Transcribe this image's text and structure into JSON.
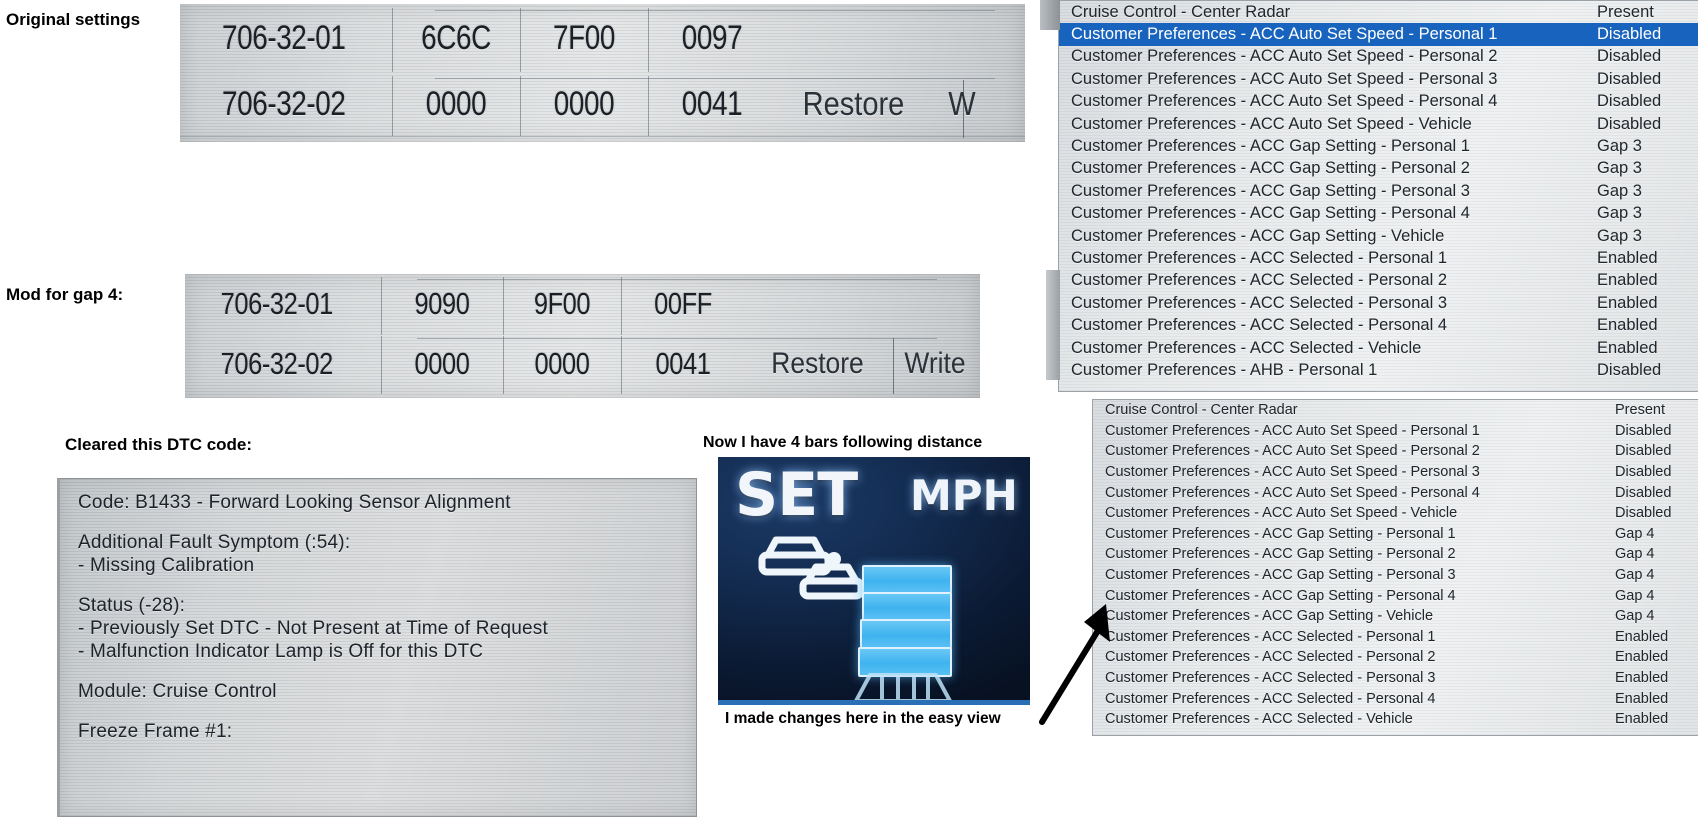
{
  "annotations": {
    "original_settings": "Original settings",
    "mod_for_gap4": "Mod for gap 4:",
    "cleared_dtc": "Cleared this DTC code:",
    "four_bars": "Now I have 4 bars following distance",
    "easy_view": "I made changes here in the easy view"
  },
  "scan_table_original": {
    "rows": [
      {
        "id": "706-32-01",
        "c1": "6C6C",
        "c2": "7F00",
        "c3": "0097"
      },
      {
        "id": "706-32-02",
        "c1": "0000",
        "c2": "0000",
        "c3": "0041"
      }
    ],
    "restore_label": "Restore",
    "write_label": "W"
  },
  "scan_table_modified": {
    "rows": [
      {
        "id": "706-32-01",
        "c1": "9090",
        "c2": "9F00",
        "c3": "00FF"
      },
      {
        "id": "706-32-02",
        "c1": "0000",
        "c2": "0000",
        "c3": "0041"
      }
    ],
    "restore_label": "Restore",
    "write_label": "Write"
  },
  "dtc_box": {
    "lines": [
      "Code: B1433 - Forward Looking Sensor Alignment",
      "",
      "Additional Fault Symptom (:54):",
      " - Missing Calibration",
      "",
      "Status (-28):",
      " - Previously Set DTC - Not Present at Time of Request",
      " - Malfunction Indicator Lamp is Off for this DTC",
      "",
      "Module: Cruise Control",
      "",
      "Freeze Frame  #1:"
    ]
  },
  "panel_before": {
    "rows": [
      {
        "label": "Cruise Control - Center Radar",
        "value": "Present",
        "selected": false
      },
      {
        "label": "Customer Preferences - ACC Auto Set Speed - Personal 1",
        "value": "Disabled",
        "selected": true
      },
      {
        "label": "Customer Preferences - ACC Auto Set Speed - Personal 2",
        "value": "Disabled",
        "selected": false
      },
      {
        "label": "Customer Preferences - ACC Auto Set Speed - Personal 3",
        "value": "Disabled",
        "selected": false
      },
      {
        "label": "Customer Preferences - ACC Auto Set Speed - Personal 4",
        "value": "Disabled",
        "selected": false
      },
      {
        "label": "Customer Preferences - ACC Auto Set Speed - Vehicle",
        "value": "Disabled",
        "selected": false
      },
      {
        "label": "Customer Preferences - ACC Gap Setting - Personal 1",
        "value": "Gap 3",
        "selected": false
      },
      {
        "label": "Customer Preferences - ACC Gap Setting - Personal 2",
        "value": "Gap 3",
        "selected": false
      },
      {
        "label": "Customer Preferences - ACC Gap Setting - Personal 3",
        "value": "Gap 3",
        "selected": false
      },
      {
        "label": "Customer Preferences - ACC Gap Setting - Personal 4",
        "value": "Gap 3",
        "selected": false
      },
      {
        "label": "Customer Preferences - ACC Gap Setting - Vehicle",
        "value": "Gap 3",
        "selected": false
      },
      {
        "label": "Customer Preferences - ACC Selected - Personal 1",
        "value": "Enabled",
        "selected": false
      },
      {
        "label": "Customer Preferences - ACC Selected - Personal 2",
        "value": "Enabled",
        "selected": false
      },
      {
        "label": "Customer Preferences - ACC Selected - Personal 3",
        "value": "Enabled",
        "selected": false
      },
      {
        "label": "Customer Preferences - ACC Selected - Personal 4",
        "value": "Enabled",
        "selected": false
      },
      {
        "label": "Customer Preferences - ACC Selected - Vehicle",
        "value": "Enabled",
        "selected": false
      },
      {
        "label": "Customer Preferences - AHB - Personal 1",
        "value": "Disabled",
        "selected": false
      }
    ]
  },
  "panel_after": {
    "rows": [
      {
        "label": "Cruise Control - Center Radar",
        "value": "Present"
      },
      {
        "label": "Customer Preferences - ACC Auto Set Speed - Personal 1",
        "value": "Disabled"
      },
      {
        "label": "Customer Preferences - ACC Auto Set Speed - Personal 2",
        "value": "Disabled"
      },
      {
        "label": "Customer Preferences - ACC Auto Set Speed - Personal 3",
        "value": "Disabled"
      },
      {
        "label": "Customer Preferences - ACC Auto Set Speed - Personal 4",
        "value": "Disabled"
      },
      {
        "label": "Customer Preferences - ACC Auto Set Speed - Vehicle",
        "value": "Disabled"
      },
      {
        "label": "Customer Preferences - ACC Gap Setting - Personal 1",
        "value": "Gap 4"
      },
      {
        "label": "Customer Preferences - ACC Gap Setting - Personal 2",
        "value": "Gap 4"
      },
      {
        "label": "Customer Preferences - ACC Gap Setting - Personal 3",
        "value": "Gap 4"
      },
      {
        "label": "Customer Preferences - ACC Gap Setting - Personal 4",
        "value": "Gap 4"
      },
      {
        "label": "Customer Preferences - ACC Gap Setting - Vehicle",
        "value": "Gap 4"
      },
      {
        "label": "Customer Preferences - ACC Selected - Personal 1",
        "value": "Enabled"
      },
      {
        "label": "Customer Preferences - ACC Selected - Personal 2",
        "value": "Enabled"
      },
      {
        "label": "Customer Preferences - ACC Selected - Personal 3",
        "value": "Enabled"
      },
      {
        "label": "Customer Preferences - ACC Selected - Personal 4",
        "value": "Enabled"
      },
      {
        "label": "Customer Preferences - ACC Selected - Vehicle",
        "value": "Enabled"
      }
    ]
  },
  "cluster": {
    "set_label": "SET",
    "mph_label": "MPH",
    "gap_bars": 4
  },
  "colors": {
    "selection_blue": "#1763bd",
    "bar_blue": "#3fb3ef",
    "cluster_bg": "#12294c"
  }
}
